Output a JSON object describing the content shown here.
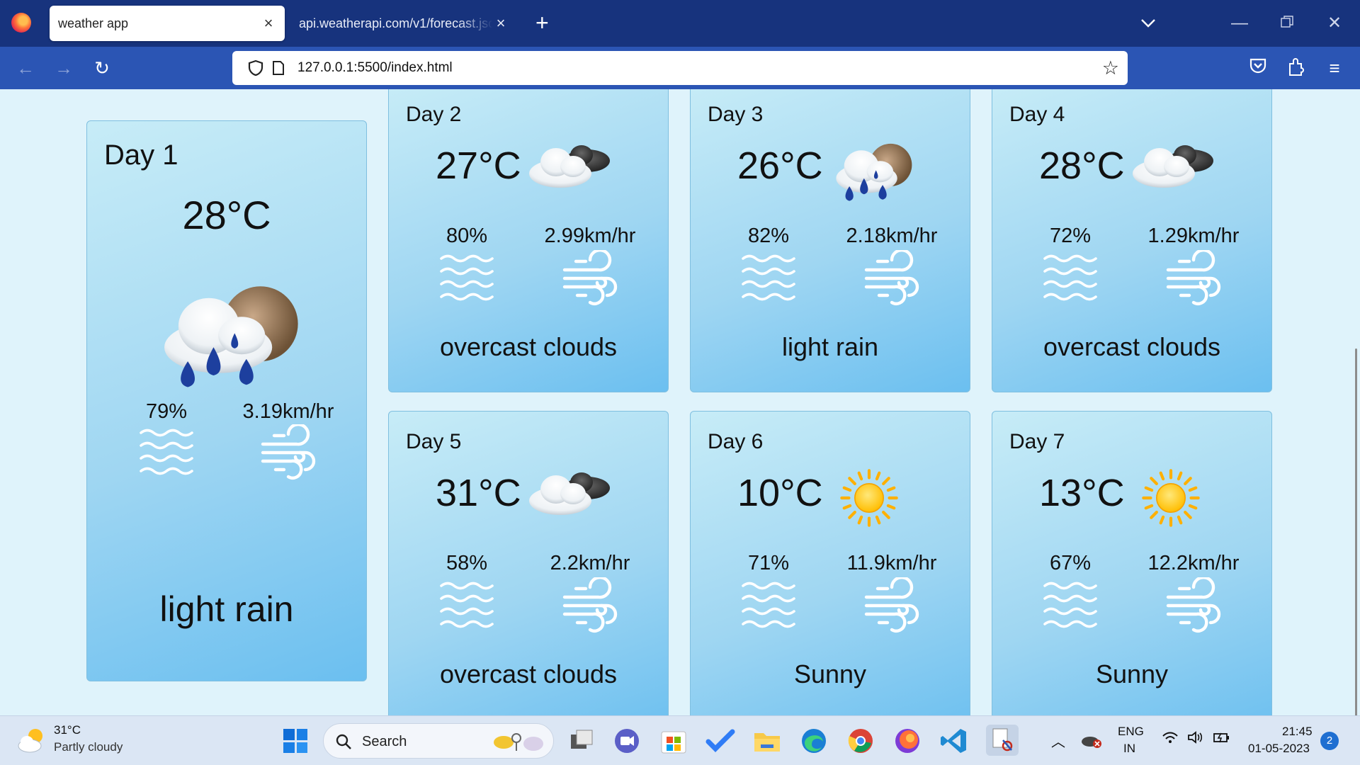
{
  "browser": {
    "tabs": [
      {
        "title": "weather app",
        "active": true
      },
      {
        "title": "api.weatherapi.com/v1/forecast.json",
        "active": false
      }
    ],
    "url": "127.0.0.1:5500/index.html"
  },
  "weather_cards": [
    {
      "day": "Day 1",
      "temp": "28°C",
      "humidity": "79%",
      "wind": "3.19km/hr",
      "condition": "light rain",
      "icon": "rain-cloud-sun-icon"
    },
    {
      "day": "Day 2",
      "temp": "27°C",
      "humidity": "80%",
      "wind": "2.99km/hr",
      "condition": "overcast clouds",
      "icon": "overcast-cloud-icon"
    },
    {
      "day": "Day 3",
      "temp": "26°C",
      "humidity": "82%",
      "wind": "2.18km/hr",
      "condition": "light rain",
      "icon": "rain-cloud-sun-icon"
    },
    {
      "day": "Day 4",
      "temp": "28°C",
      "humidity": "72%",
      "wind": "1.29km/hr",
      "condition": "overcast clouds",
      "icon": "overcast-cloud-icon"
    },
    {
      "day": "Day 5",
      "temp": "31°C",
      "humidity": "58%",
      "wind": "2.2km/hr",
      "condition": "overcast clouds",
      "icon": "overcast-cloud-icon"
    },
    {
      "day": "Day 6",
      "temp": "10°C",
      "humidity": "71%",
      "wind": "11.9km/hr",
      "condition": "Sunny",
      "icon": "sun-icon"
    },
    {
      "day": "Day 7",
      "temp": "13°C",
      "humidity": "67%",
      "wind": "12.2km/hr",
      "condition": "Sunny",
      "icon": "sun-icon"
    }
  ],
  "taskbar": {
    "weather_temp": "31°C",
    "weather_condition": "Partly cloudy",
    "search_label": "Search",
    "language": "ENG",
    "region": "IN",
    "time": "21:45",
    "date": "01-05-2023",
    "notification_count": "2"
  },
  "colors": {
    "tabbar": "#17337d",
    "navbar": "#2b55b4",
    "page_background": "#dff3fb",
    "card_gradient_start": "#c7ecf7",
    "card_gradient_end": "#6bbff0",
    "raindrop": "#1d3f9e",
    "sun": "#ffc400"
  }
}
